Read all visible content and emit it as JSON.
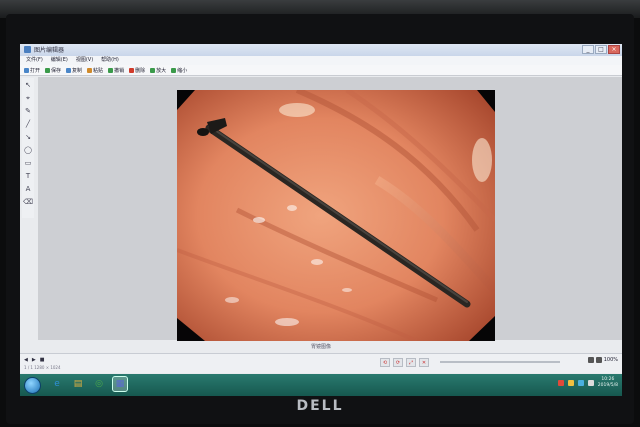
{
  "window": {
    "title": "图片编辑器",
    "buttons": [
      "_",
      "□",
      "×"
    ]
  },
  "menu": [
    "文件(F)",
    "编辑(E)",
    "视图(V)",
    "帮助(H)"
  ],
  "toolbar": [
    {
      "label": "打开",
      "color": "#4a86c8"
    },
    {
      "label": "保存",
      "color": "#3a9a4a"
    },
    {
      "label": "复制",
      "color": "#4a86c8"
    },
    {
      "label": "粘贴",
      "color": "#d08a2a"
    },
    {
      "label": "撤销",
      "color": "#3a9a4a"
    },
    {
      "label": "删除",
      "color": "#d03a2a"
    },
    {
      "label": "放大",
      "color": "#3a9a4a"
    },
    {
      "label": "缩小",
      "color": "#3a9a4a"
    }
  ],
  "palette": [
    "↖",
    "⌖",
    "✎",
    "╱",
    "↘",
    "◯",
    "▭",
    "T",
    "A",
    "⌫"
  ],
  "photo_caption": "胃镜图像",
  "status": {
    "left_buttons": [
      "◀",
      "▶",
      "■"
    ],
    "info": "1 / 1   1280 × 1024",
    "center_buttons": [
      "⟲",
      "⟳",
      "⤢",
      "✕"
    ],
    "right_text": "100%"
  },
  "taskbar": {
    "apps": [
      {
        "icon": "e",
        "color": "#2f8fd8"
      },
      {
        "icon": "▤",
        "color": "#e0b040"
      },
      {
        "icon": "◎",
        "color": "#4aa84a"
      },
      {
        "icon": "▦",
        "color": "#5a6ad0",
        "active": true
      }
    ],
    "tray_colors": [
      "#e04a3a",
      "#f0c040",
      "#4ab0e0",
      "#dcdcdc"
    ],
    "time": "10:26",
    "date": "2019/5/8"
  },
  "logo": "DELL"
}
